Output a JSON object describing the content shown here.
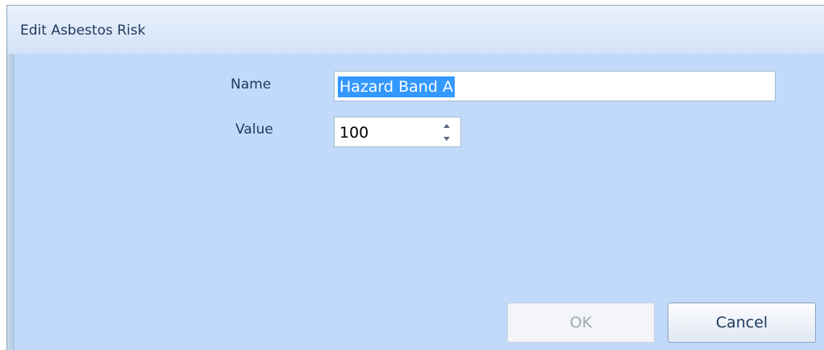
{
  "window": {
    "title": "Edit Asbestos Risk"
  },
  "form": {
    "name_label": "Name",
    "name_value": "Hazard Band A",
    "value_label": "Value",
    "value_value": "100"
  },
  "buttons": {
    "ok_label": "OK",
    "ok_enabled": false,
    "cancel_label": "Cancel"
  },
  "icons": {
    "spin_up": "chevron-up-icon",
    "spin_down": "chevron-down-icon"
  },
  "colors": {
    "dialog_background": "#c1daf9",
    "selection_highlight": "#3399ff",
    "label_text": "#1e395b"
  }
}
